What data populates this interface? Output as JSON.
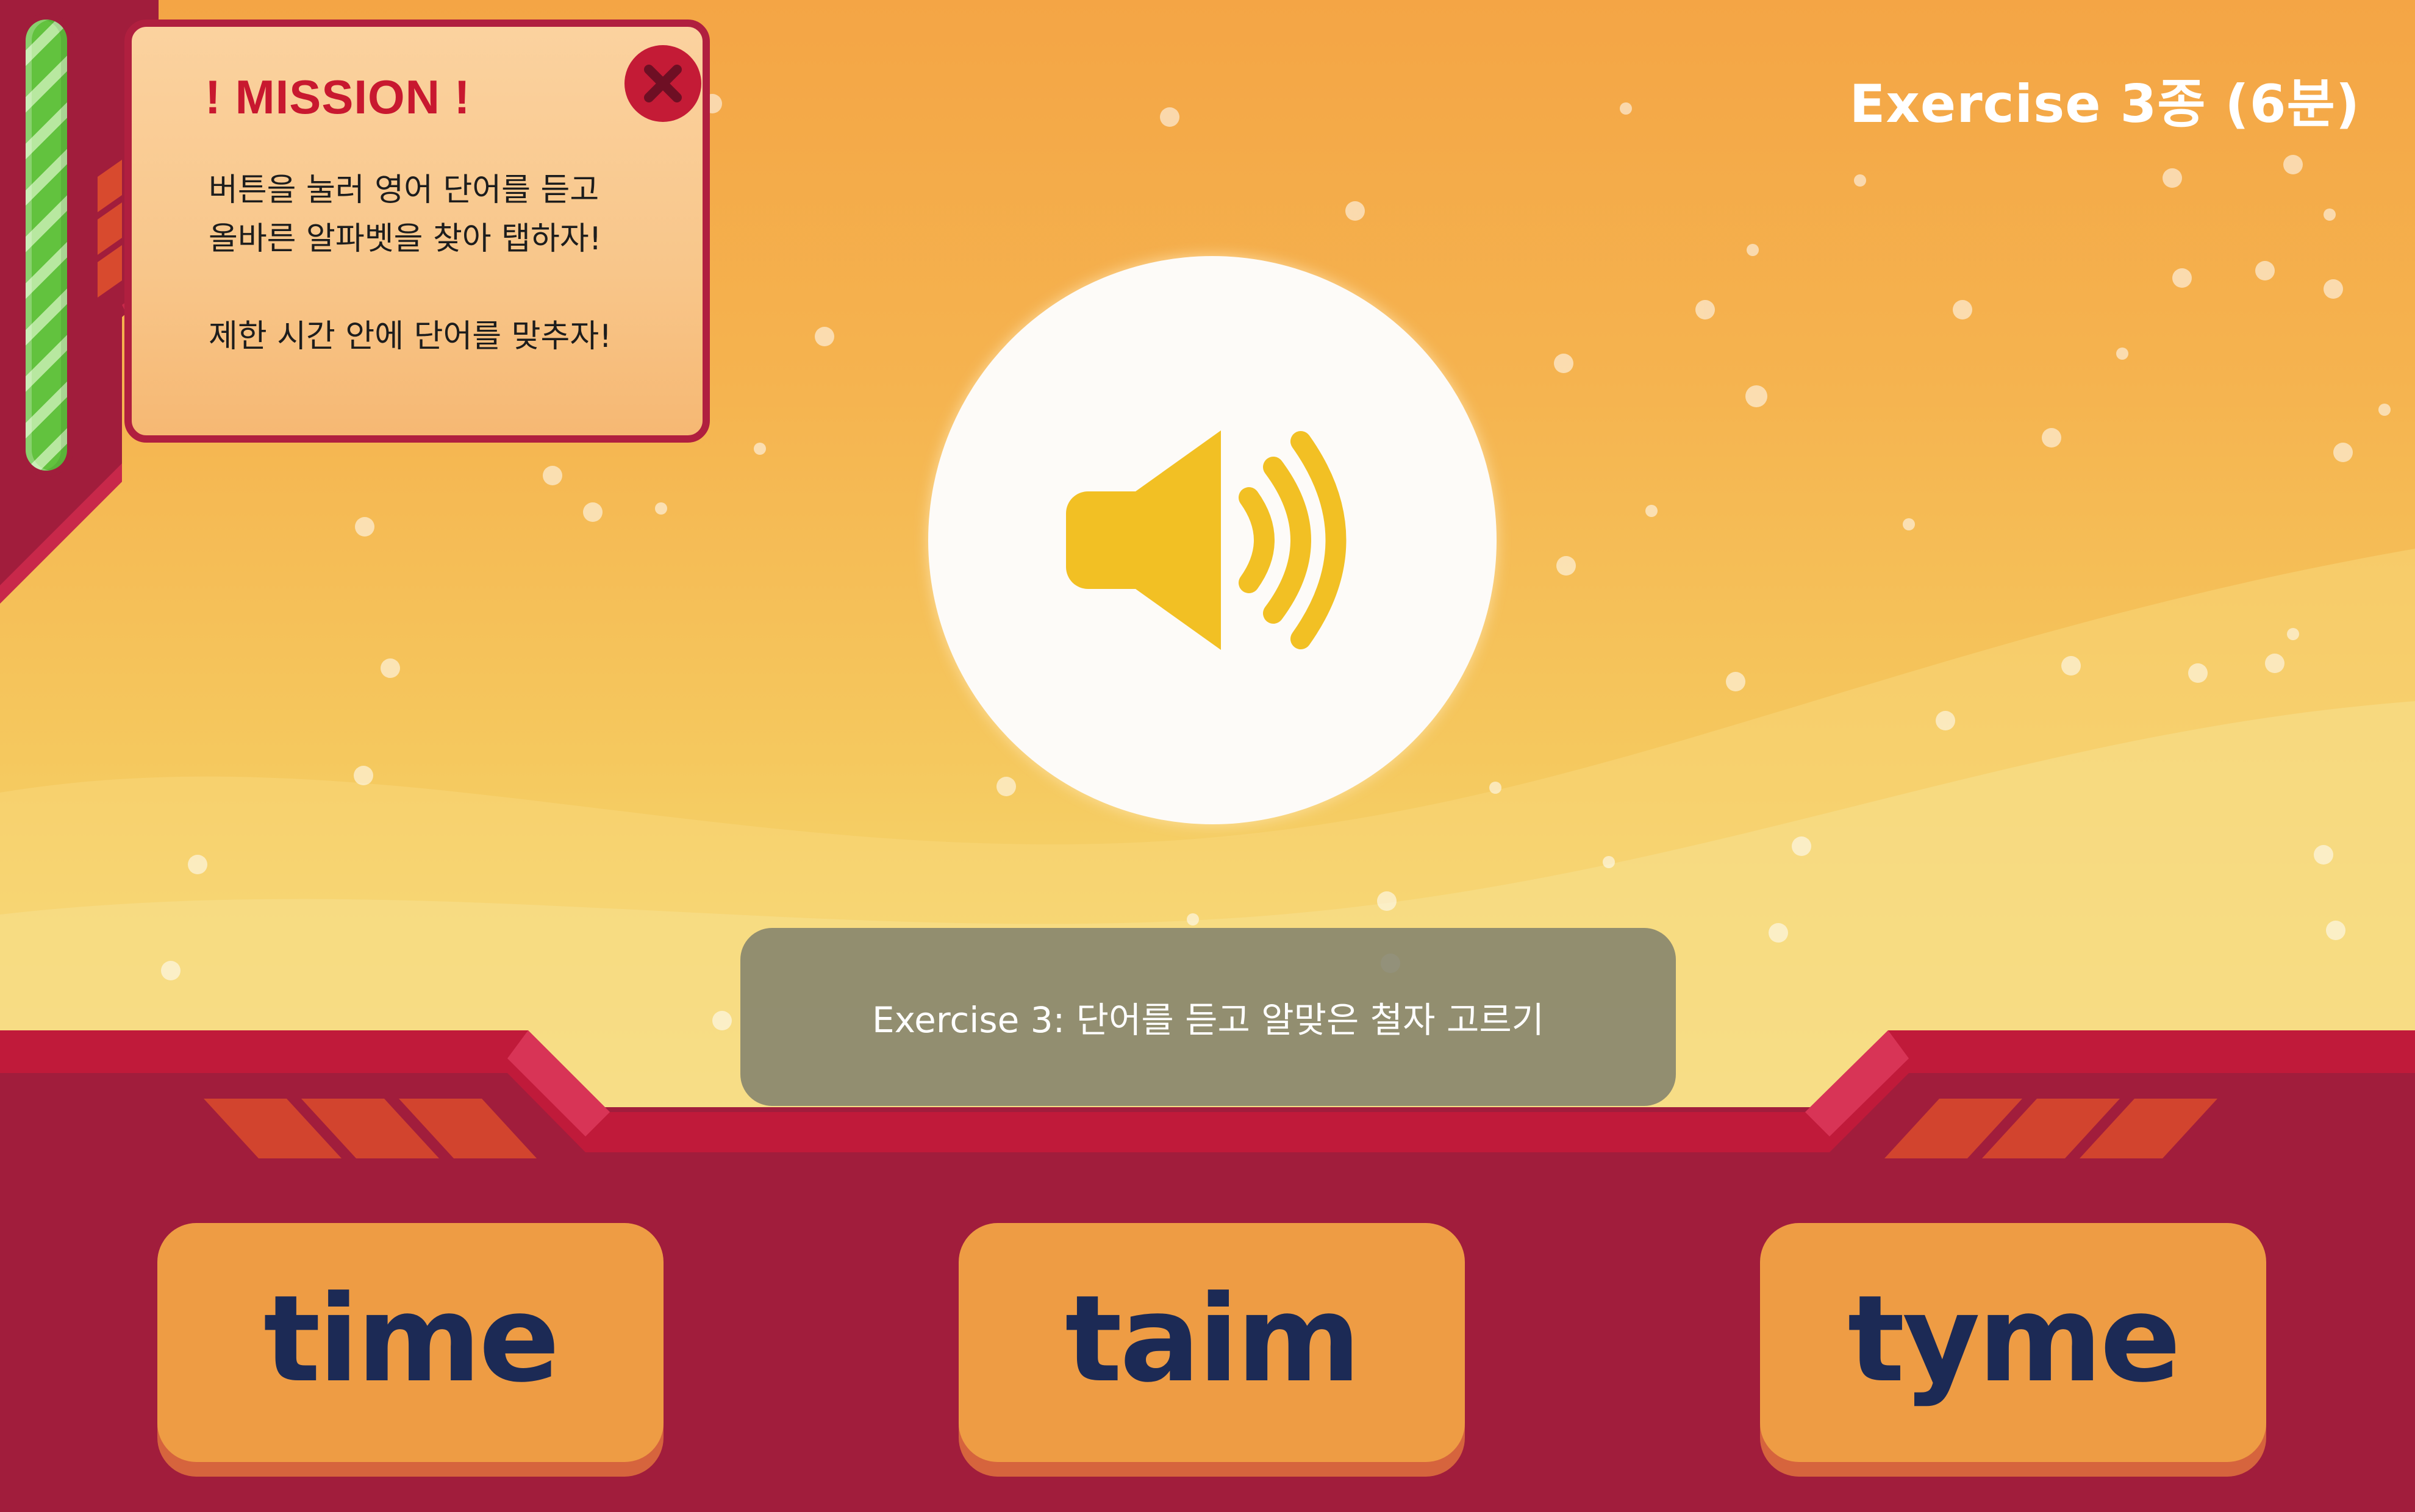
{
  "header": {
    "exercise_title": "Exercise 3종 (6분)"
  },
  "mission": {
    "title": "! MISSION !",
    "line1": "버튼을 눌러 영어 단어를 듣고",
    "line2": "올바른 알파벳을 찾아 탭하자!",
    "line3": "제한 시간 안에 단어를 맞추자!"
  },
  "progress": {
    "fraction": 1.0
  },
  "instruction": {
    "text": "Exercise 3: 단어를 듣고 알맞은 철자 고르기"
  },
  "answers": [
    {
      "label": "time"
    },
    {
      "label": "taim"
    },
    {
      "label": "tyme"
    }
  ],
  "icons": {
    "speaker": "speaker-icon",
    "close": "close-icon"
  },
  "colors": {
    "frame_red": "#a11d3c",
    "accent_red": "#c8182f",
    "button_orange": "#ee9c44",
    "button_text": "#1c2a55",
    "speaker_yellow": "#f2c024",
    "progress_green": "#62c23e"
  }
}
